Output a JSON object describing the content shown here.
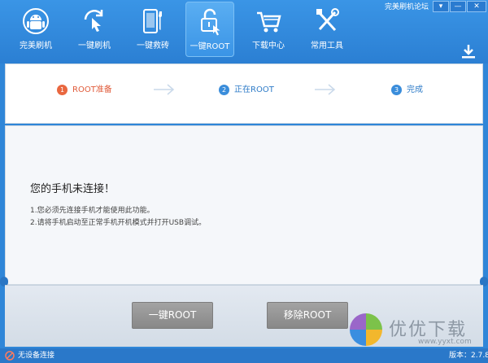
{
  "header": {
    "forum_link": "完美刷机论坛",
    "nav": [
      {
        "label": "完美刷机",
        "icon": "android-robot-icon"
      },
      {
        "label": "一键刷机",
        "icon": "touch-refresh-icon"
      },
      {
        "label": "一键救砖",
        "icon": "phone-wrench-icon"
      },
      {
        "label": "一键ROOT",
        "icon": "unlock-icon",
        "active": true
      },
      {
        "label": "下载中心",
        "icon": "cart-icon"
      },
      {
        "label": "常用工具",
        "icon": "tools-icon"
      }
    ]
  },
  "steps": [
    {
      "number": "1",
      "label": "ROOT准备",
      "state": "current"
    },
    {
      "number": "2",
      "label": "正在ROOT",
      "state": "pending"
    },
    {
      "number": "3",
      "label": "完成",
      "state": "pending"
    }
  ],
  "message": {
    "title": "您的手机未连接！",
    "lines": [
      "1.您必须先连接手机才能使用此功能。",
      "2.请将手机启动至正常手机开机模式并打开USB调试。"
    ]
  },
  "actions": {
    "root_label": "一键ROOT",
    "remove_root_label": "移除ROOT"
  },
  "watermark": {
    "text": "优优下载",
    "url": "www.yyxt.com"
  },
  "status": {
    "connection": "无设备连接",
    "version": "版本：2.7.8"
  },
  "colors": {
    "header_blue": "#2f86d8",
    "active_step": "#e9673f",
    "pending_step": "#3a8ddb",
    "button_gray": "#999999"
  }
}
